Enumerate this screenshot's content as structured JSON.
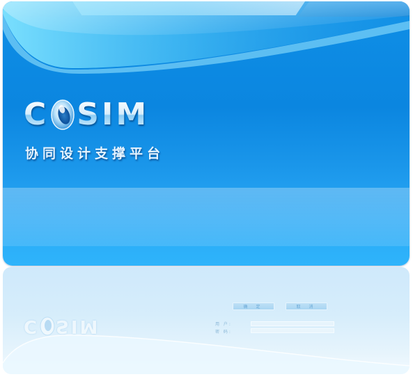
{
  "splash": {
    "logo_left": "C",
    "logo_right": "SIM",
    "subtitle": "协同设计支撑平台"
  },
  "login": {
    "ok_label": "确 定",
    "cancel_label": "取 消",
    "username_label": "用 户:",
    "password_label": "密 码:",
    "username_value": "",
    "password_value": ""
  },
  "colors": {
    "panel_blue": "#0b86e0",
    "panel_light_blue": "#2eb4fb",
    "reflection": "#d6edfb"
  },
  "icons": {
    "logo_orb": "blue-disc-orb"
  }
}
